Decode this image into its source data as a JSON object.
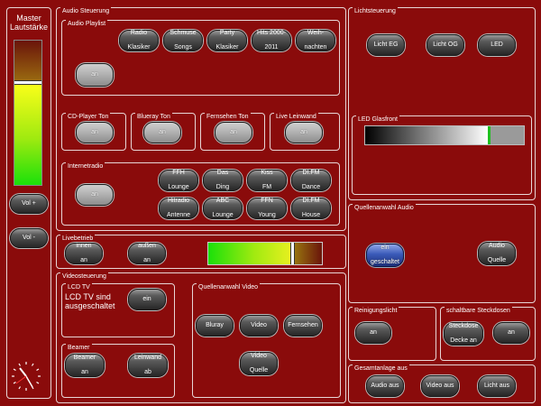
{
  "master": {
    "title_line1": "Master",
    "title_line2": "Lautstärke",
    "level": 0.85,
    "vol_plus": "Vol +",
    "vol_minus": "Vol -"
  },
  "audio": {
    "title": "Audio Steuerung",
    "playlist": {
      "title": "Audio Playlist",
      "buttons": [
        {
          "l1": "Radio",
          "l2": "Klasiker"
        },
        {
          "l1": "Schmuse",
          "l2": "Songs"
        },
        {
          "l1": "Party",
          "l2": "Klasiker"
        },
        {
          "l1": "Hits 2000-",
          "l2": "2011"
        },
        {
          "l1": "Weih-",
          "l2": "nachten"
        }
      ],
      "on_label": "an"
    },
    "cd": {
      "title": "CD-Player Ton",
      "btn": "an"
    },
    "bluray": {
      "title": "Blueray Ton",
      "btn": "an"
    },
    "tv": {
      "title": "Fernsehen Ton",
      "btn": "an"
    },
    "live": {
      "title": "Live Leinwand",
      "btn": "an"
    },
    "internet": {
      "title": "Internetradio",
      "on_label": "an",
      "stations": [
        {
          "l1": "FFH",
          "l2": "Lounge"
        },
        {
          "l1": "Das",
          "l2": "Ding"
        },
        {
          "l1": "Kiss",
          "l2": "FM"
        },
        {
          "l1": "DI.FM",
          "l2": "Dance"
        },
        {
          "l1": "Hitradio",
          "l2": "Antenne"
        },
        {
          "l1": "ABC",
          "l2": "Lounge"
        },
        {
          "l1": "FFN",
          "l2": "Young"
        },
        {
          "l1": "DI.FM",
          "l2": "House"
        }
      ]
    }
  },
  "live": {
    "title": "Livebetrieb",
    "inside": {
      "l1": "innen",
      "l2": "an"
    },
    "outside": {
      "l1": "außen",
      "l2": "an"
    },
    "level": 0.78
  },
  "video": {
    "title": "Videosteuerung",
    "lcd": {
      "title": "LCD TV",
      "status_l1": "LCD TV sind",
      "status_l2": "ausgeschaltet",
      "btn": "ein"
    },
    "beamer": {
      "title": "Beamer",
      "b1": {
        "l1": "Beamer",
        "l2": "an"
      },
      "b2": {
        "l1": "Leinwand",
        "l2": "ab"
      }
    },
    "source": {
      "title": "Quellenanwahl Video",
      "bluray": "Bluray",
      "video": "Video",
      "tv": "Fernsehen",
      "vq": {
        "l1": "Video",
        "l2": "Quelle"
      }
    }
  },
  "light": {
    "title": "Lichtsteuerung",
    "eg": "Licht EG",
    "og": "Licht OG",
    "led": "LED",
    "glass": {
      "title": "LED Glasfront",
      "level": 0.68
    }
  },
  "audio_source": {
    "title": "Quellenanwahl Audio",
    "on": {
      "l1": "ein",
      "l2": "geschaltet"
    },
    "src": {
      "l1": "Audio",
      "l2": "Quelle"
    }
  },
  "cleaning": {
    "title": "Reinigungslicht",
    "btn": "an"
  },
  "sockets": {
    "title": "schaltbare Steckdosen",
    "b1": {
      "l1": "Steckdose",
      "l2": "Decke an"
    },
    "b2": "an"
  },
  "total": {
    "title": "Gesamtanlage aus",
    "audio": "Audio aus",
    "video": "Video aus",
    "light": "Licht aus"
  }
}
